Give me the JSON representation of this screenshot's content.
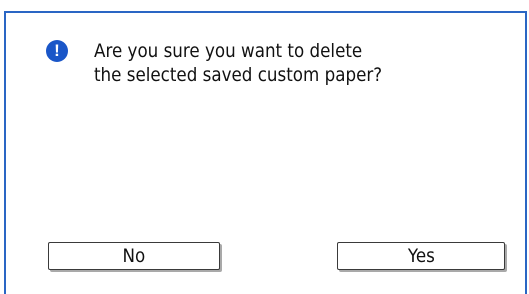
{
  "dialog": {
    "icon": "info-exclamation-icon",
    "message_line1": "Are you sure you want to delete",
    "message_line2": "the selected saved custom paper?",
    "no_label": "No",
    "yes_label": "Yes"
  },
  "colors": {
    "accent": "#2a66c4",
    "icon_fill": "#1a56c8"
  }
}
